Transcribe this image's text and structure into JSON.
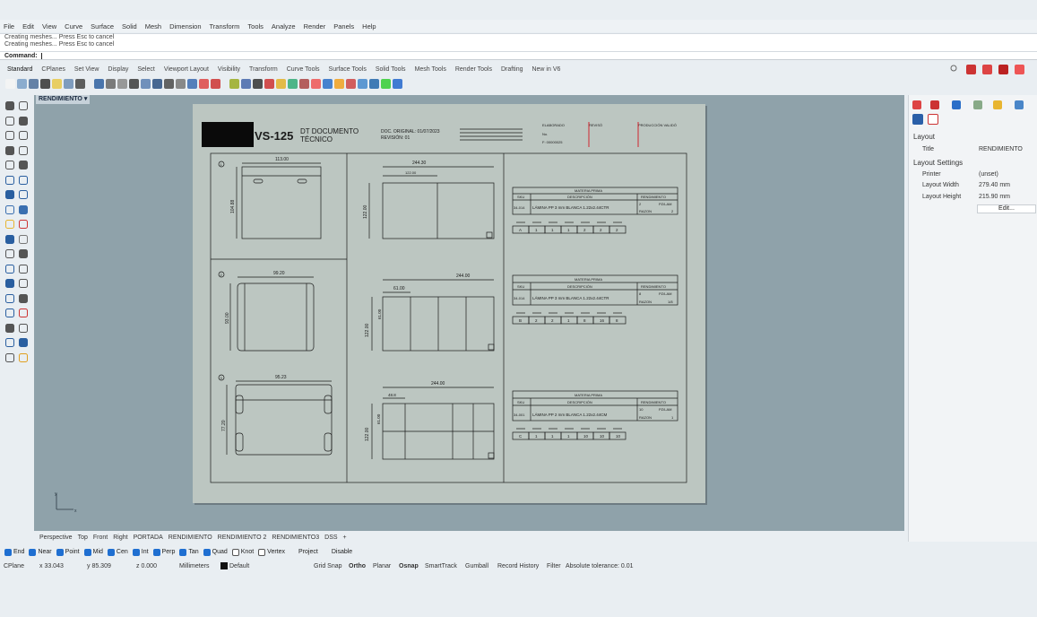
{
  "menu": [
    "File",
    "Edit",
    "View",
    "Curve",
    "Surface",
    "Solid",
    "Mesh",
    "Dimension",
    "Transform",
    "Tools",
    "Analyze",
    "Render",
    "Panels",
    "Help"
  ],
  "history": [
    "Creating meshes... Press Esc to cancel",
    "Creating meshes... Press Esc to cancel"
  ],
  "command_label": "Command:",
  "toolbar_tabs": [
    "Standard",
    "CPlanes",
    "Set View",
    "Display",
    "Select",
    "Viewport Layout",
    "Visibility",
    "Transform",
    "Curve Tools",
    "Surface Tools",
    "Solid Tools",
    "Mesh Tools",
    "Render Tools",
    "Drafting",
    "New in V6"
  ],
  "viewport_title": "RENDIMIENTO",
  "view_tabs": [
    "Perspective",
    "Top",
    "Front",
    "Right",
    "PORTADA",
    "RENDIMIENTO",
    "RENDIMIENTO 2",
    "RENDIMIENTO3",
    "DSS",
    "+"
  ],
  "osnaps": [
    {
      "label": "End",
      "on": true
    },
    {
      "label": "Near",
      "on": true
    },
    {
      "label": "Point",
      "on": true
    },
    {
      "label": "Mid",
      "on": true
    },
    {
      "label": "Cen",
      "on": true
    },
    {
      "label": "Int",
      "on": true
    },
    {
      "label": "Perp",
      "on": true
    },
    {
      "label": "Tan",
      "on": true
    },
    {
      "label": "Quad",
      "on": true
    },
    {
      "label": "Knot",
      "on": false
    },
    {
      "label": "Vertex",
      "on": false
    }
  ],
  "osnap_extra": [
    "Project",
    "Disable"
  ],
  "status": {
    "cplane": "CPlane",
    "x": "x 33.043",
    "y": "y 85.309",
    "z": "z 0.000",
    "units": "Millimeters",
    "layer": "Default",
    "toggles": [
      "Grid Snap",
      "Ortho",
      "Planar",
      "Osnap",
      "SmartTrack",
      "Gumball",
      "Record History",
      "Filter"
    ],
    "tolerance": "Absolute tolerance: 0.01"
  },
  "panel": {
    "section_layout": "Layout",
    "title_label": "Title",
    "title_value": "RENDIMIENTO",
    "section_settings": "Layout Settings",
    "printer_label": "Printer",
    "printer_value": "(unset)",
    "width_label": "Layout Width",
    "width_value": "279.40 mm",
    "height_label": "Layout Height",
    "height_value": "215.90 mm",
    "edit_button": "Edit..."
  },
  "drawing": {
    "code": "VS-125",
    "doc_title_1": "DT DOCUMENTO",
    "doc_title_2": "TÉCNICO",
    "date": "DOC. ORIGINAL: 01/07/2023",
    "revision": "REVISIÓN: 01",
    "label_a": "ELABORADO",
    "label_b": "REVISÓ",
    "label_c": "PRODUCCIÓN VALIDÓ",
    "label_d": "No.",
    "label_e": "F: 00000025",
    "dims": {
      "a_width": "113.00",
      "a_height": "104.88",
      "a_top": "244.30",
      "a_inner": "122.00",
      "a_side": "122.00",
      "b_width": "99.20",
      "b_height": "93.00",
      "b_top": "244.00",
      "b_inner": "61.00",
      "b_side1": "61.00",
      "b_side2": "122.00",
      "c_width": "95.23",
      "c_height": "77.20",
      "c_top": "244.00",
      "c_inner": "48.8",
      "c_side1": "61.00",
      "c_side2": "122.00"
    },
    "table_header": "MATERIA PRIMA",
    "col_sku": "SKU",
    "col_desc": "DESCRIPCIÓN",
    "col_rend": "RENDIMIENTO",
    "row_a": {
      "sku": "34-014",
      "desc": "LÁMINA PP 3 mm BLANCA 1.22x2.44CTR",
      "n": "2",
      "unit": "PZ/LAM",
      "razon": "RAZON",
      "rv": "2"
    },
    "row_b": {
      "sku": "34-014",
      "desc": "LÁMINA PP 3 mm BLANCA 1.22x2.44CTR",
      "n": "8",
      "unit": "PZ/LAM",
      "razon": "RAZON",
      "rv": "1/8"
    },
    "row_c": {
      "sku": "34-001",
      "desc": "LÁMINA PP 2 mm BLANCA 1.22x2.44CM",
      "n": "10",
      "unit": "PZ/LAM",
      "razon": "RAZON",
      "rv": "1"
    },
    "strip_a": [
      "A",
      "1",
      "1",
      "1",
      "2",
      "2",
      "2"
    ],
    "strip_b": [
      "B",
      "2",
      "2",
      "1",
      "8",
      "16",
      "8"
    ],
    "strip_c": [
      "C",
      "1",
      "1",
      "1",
      "10",
      "10",
      "10"
    ],
    "markers": [
      "1",
      "2",
      "3"
    ]
  },
  "colors": {
    "viewport": "#8fa2aa",
    "sheet": "#bcc6c1",
    "ink": "#1a1a1a",
    "accent": "#1f6fd1",
    "redline": "#d0262e"
  }
}
